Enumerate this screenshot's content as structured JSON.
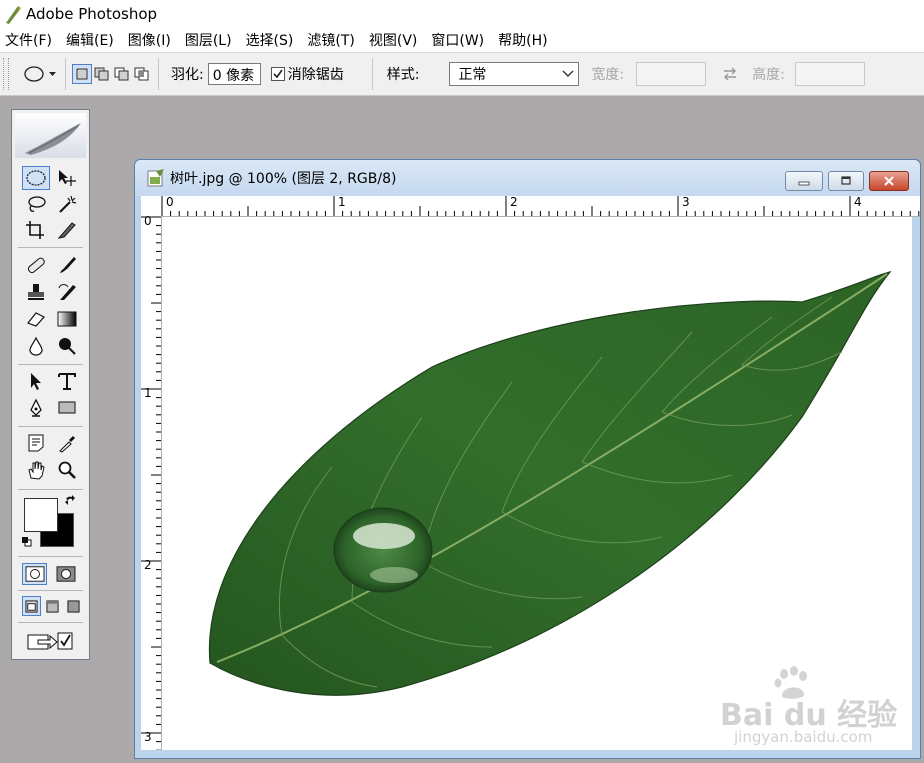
{
  "app": {
    "title": "Adobe Photoshop"
  },
  "menu": [
    "文件(F)",
    "编辑(E)",
    "图像(I)",
    "图层(L)",
    "选择(S)",
    "滤镜(T)",
    "视图(V)",
    "窗口(W)",
    "帮助(H)"
  ],
  "options": {
    "feather_label": "羽化:",
    "feather_value": "0 像素",
    "antialias_label": "消除锯齿",
    "style_label": "样式:",
    "style_value": "正常",
    "width_label": "宽度:",
    "height_label": "高度:"
  },
  "document": {
    "title": "树叶.jpg @ 100% (图层 2, RGB/8)",
    "ruler_top": [
      "0",
      "1",
      "2",
      "3",
      "4"
    ],
    "ruler_left": [
      "0",
      "1",
      "2",
      "3"
    ]
  },
  "watermark": {
    "brand": "Bai du 经验",
    "url": "jingyan.baidu.com"
  },
  "colors": {
    "leaf": "#2f6a2a",
    "canvas": "#ffffff",
    "workspace": "#aba9a9",
    "accent": "#4d7ec6"
  }
}
